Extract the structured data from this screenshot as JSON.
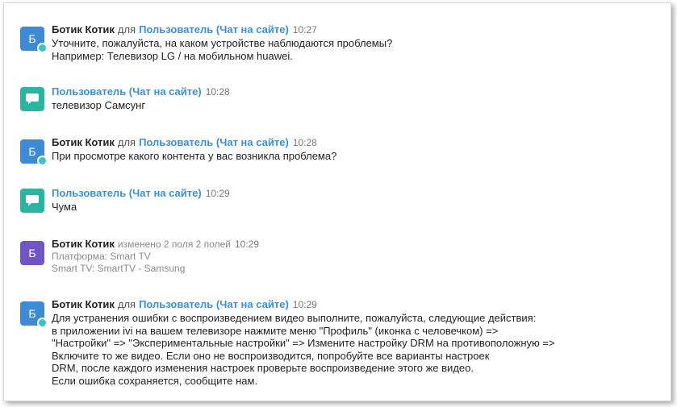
{
  "messages": [
    {
      "avatar_letter": "Б",
      "author": "Ботик Котик",
      "for_word": "для",
      "recipient": "Пользователь (Чат на сайте)",
      "time": "10:27",
      "lines": [
        "Уточните, пожалуйста, на каком устройстве наблюдаются проблемы?",
        "Например: Телевизор LG / на мобильном huawei."
      ]
    },
    {
      "author": "Пользователь (Чат на сайте)",
      "time": "10:28",
      "lines": [
        "телевизор Самсунг"
      ]
    },
    {
      "avatar_letter": "Б",
      "author": "Ботик Котик",
      "for_word": "для",
      "recipient": "Пользователь (Чат на сайте)",
      "time": "10:28",
      "lines": [
        "При просмотре какого контента у вас возникла проблема?"
      ]
    },
    {
      "author": "Пользователь (Чат на сайте)",
      "time": "10:29",
      "lines": [
        "Чума"
      ]
    },
    {
      "avatar_letter": "Б",
      "author": "Ботик Котик",
      "action": "изменено 2 поля 2 полей",
      "time": "10:29",
      "lines": [
        "Платформа: Smart TV",
        "Smart TV: SmartTV - Samsung"
      ]
    },
    {
      "avatar_letter": "Б",
      "author": "Ботик Котик",
      "for_word": "для",
      "recipient": "Пользователь (Чат на сайте)",
      "time": "10:29",
      "lines": [
        "Для устранения ошибки с воспроизведением видео выполните, пожалуйста, следующие действия:",
        "в приложении ivi на вашем телевизоре нажмите меню \"Профиль\" (иконка с человечком) =>",
        "\"Настройки\" => \"Экспериментальные настройки\" => Измените настройку DRM на противоположную =>",
        "Включите то же видео. Если оно не воспроизводится, попробуйте все варианты настроек",
        "DRM, после каждого изменения настроек проверьте воспроизведение этого же видео.",
        "Если ошибка сохраняется, сообщите нам."
      ]
    }
  ],
  "colors": {
    "bot_avatar": "#3e8ad5",
    "system_avatar": "#7155c7",
    "user_avatar": "#2bb5a0",
    "link": "#3d8fd6"
  },
  "icons": {
    "user_avatar_icon": "chat-bubble-icon",
    "status_icon": "online-status-icon"
  }
}
